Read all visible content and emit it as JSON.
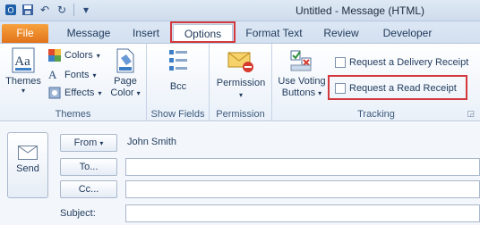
{
  "window": {
    "title": "Untitled - Message (HTML)"
  },
  "tabs": [
    "File",
    "Message",
    "Insert",
    "Options",
    "Format Text",
    "Review",
    "Developer"
  ],
  "ribbon": {
    "themes_group": {
      "themes_label": "Themes",
      "colors_label": "Colors",
      "fonts_label": "Fonts",
      "effects_label": "Effects",
      "page_color_line1": "Page",
      "page_color_line2": "Color",
      "group_label": "Themes"
    },
    "show_fields_group": {
      "bcc_label": "Bcc",
      "group_label": "Show Fields"
    },
    "permission_group": {
      "permission_label": "Permission",
      "group_label": "Permission"
    },
    "tracking_group": {
      "voting_line1": "Use Voting",
      "voting_line2": "Buttons",
      "delivery_receipt_label": "Request a Delivery Receipt",
      "read_receipt_label": "Request a Read Receipt",
      "group_label": "Tracking"
    }
  },
  "compose": {
    "send_label": "Send",
    "from_label": "From",
    "from_value": "John Smith",
    "to_label": "To...",
    "cc_label": "Cc...",
    "subject_label": "Subject:"
  }
}
